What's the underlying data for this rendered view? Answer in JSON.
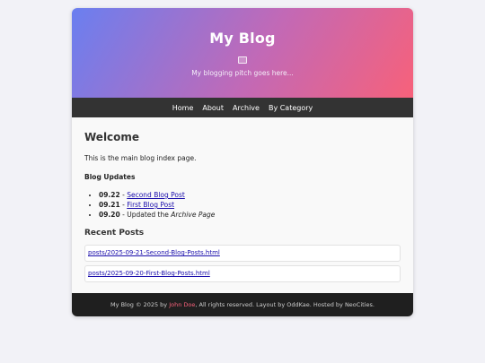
{
  "header": {
    "title": "My Blog",
    "pitch": "My blogging pitch goes here..."
  },
  "nav": {
    "items": [
      "Home",
      "About",
      "Archive",
      "By Category"
    ]
  },
  "main": {
    "heading": "Welcome",
    "intro": "This is the main blog index page.",
    "updates_heading": "Blog Updates",
    "updates": [
      {
        "date": "09.22",
        "sep": " - ",
        "link": "Second Blog Post"
      },
      {
        "date": "09.21",
        "sep": " - ",
        "link": "First Blog Post"
      },
      {
        "date": "09.20",
        "sep": " - ",
        "text": "Updated the ",
        "italic": "Archive Page"
      }
    ],
    "recent_heading": "Recent Posts",
    "recent_posts": [
      "posts/2025-09-21-Second-Blog-Posts.html",
      "posts/2025-09-20-First-Blog-Posts.html"
    ]
  },
  "footer": {
    "prefix": "My Blog © 2025 by ",
    "author": "John Doe",
    "suffix": ", All rights reserved. Layout by OddKae. Hosted by NeoCities."
  },
  "colors": {
    "gradient_start": "#6a7ff0",
    "gradient_end": "#f7617a",
    "nav_bg": "#333333",
    "footer_bg": "#1f1f1f",
    "link": "#1a0dab",
    "author": "#f7617a"
  }
}
